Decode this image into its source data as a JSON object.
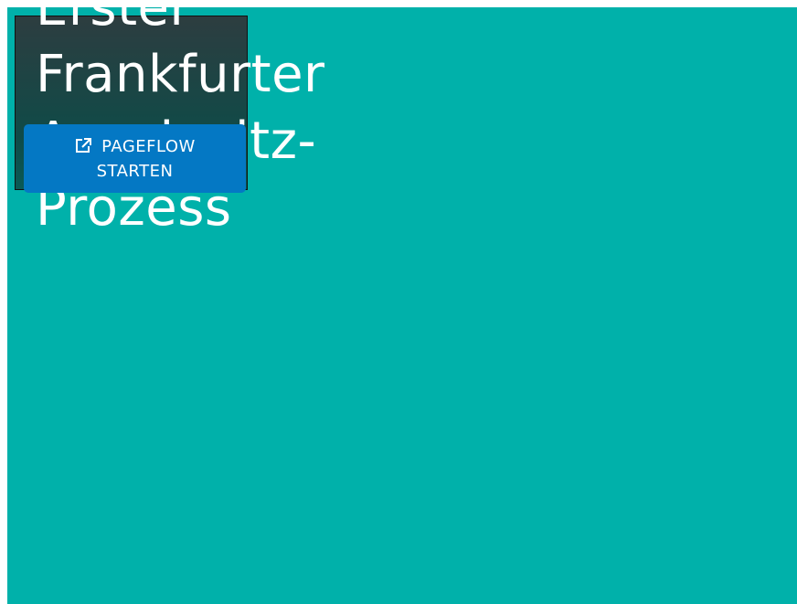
{
  "colors": {
    "page_background": "#00b1aa",
    "card_gradient_top": "#2d3d40",
    "card_gradient_bottom": "#0a5a55",
    "button_background": "#0478c4",
    "text": "#ffffff"
  },
  "card": {
    "title": "Erster Frankfurter Auschwitz-Prozess",
    "button_label": "PAGEFLOW STARTEN",
    "button_icon": "external-link-icon"
  }
}
